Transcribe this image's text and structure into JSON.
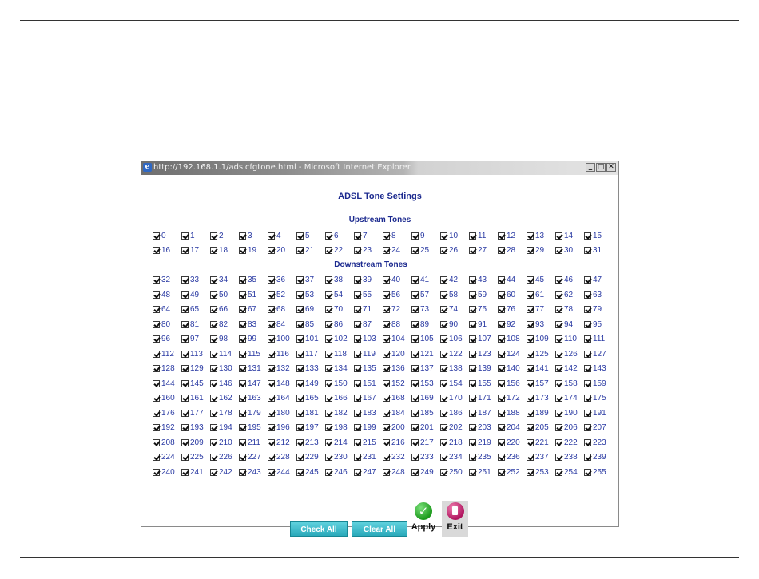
{
  "window": {
    "title": "http://192.168.1.1/adslcfgtone.html - Microsoft Internet Explorer",
    "minimize_glyph": "_",
    "maximize_glyph": "□",
    "close_glyph": "✕"
  },
  "page": {
    "title": "ADSL Tone Settings",
    "upstream_label": "Upstream Tones",
    "downstream_label": "Downstream Tones"
  },
  "tones": {
    "first": 0,
    "last": 255,
    "upstream_count": 32,
    "columns": 16,
    "checked_state": true
  },
  "buttons": {
    "check_all": "Check All",
    "clear_all": "Clear All",
    "apply": "Apply",
    "exit": "Exit"
  },
  "icons": {
    "browser": "ie-icon",
    "apply": "checkmark-icon",
    "exit": "exit-door-icon"
  },
  "colors": {
    "text_blue": "#2a3aa3",
    "title_blue": "#1c2a8f",
    "button_cyan": "#2aa9ba",
    "apply_green": "#1c9a1c",
    "exit_magenta": "#b0155f"
  }
}
